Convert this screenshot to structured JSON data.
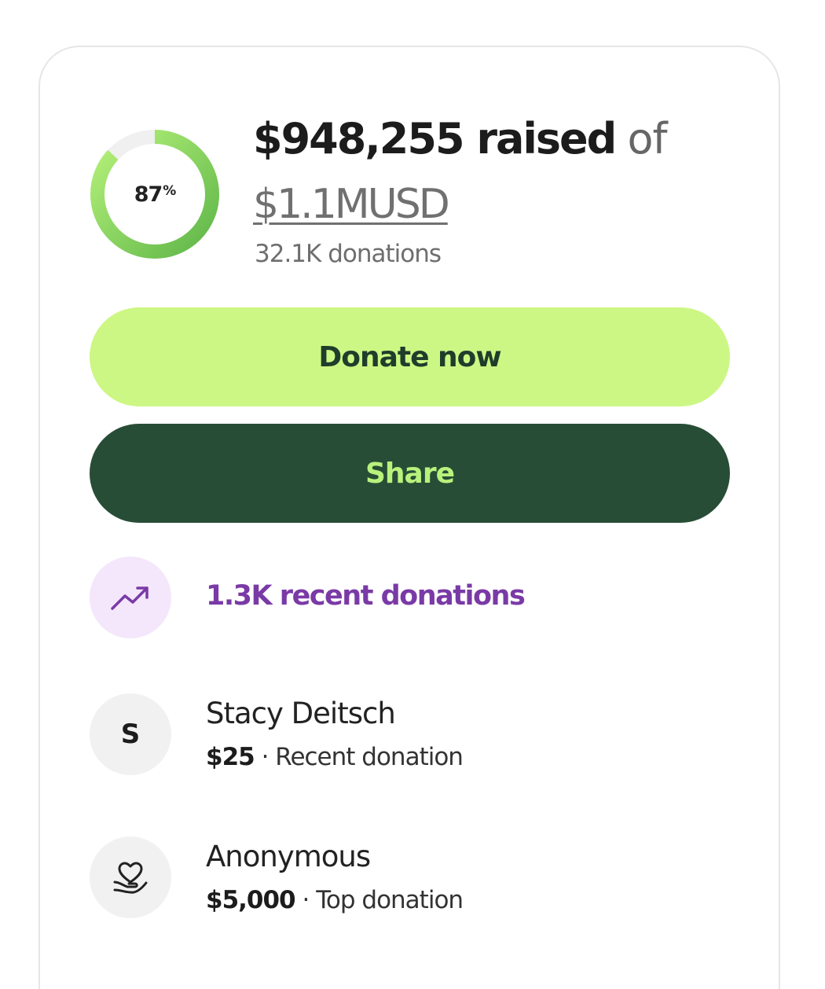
{
  "progress": {
    "percent_label": "87",
    "percent_sign": "%",
    "fraction": 0.87
  },
  "raised": {
    "amount": "$948,255 raised",
    "of": "of",
    "goal": "$1.1MUSD",
    "donations_count": "32.1K donations"
  },
  "buttons": {
    "donate_label": "Donate now",
    "share_label": "Share"
  },
  "trend": {
    "text": "1.3K recent donations",
    "icon": "trending-up-icon"
  },
  "donors": [
    {
      "avatar_letter": "S",
      "name": "Stacy Deitsch",
      "amount": "$25",
      "separator": "·",
      "type": "Recent donation"
    },
    {
      "avatar_icon": "heart-hand-icon",
      "name": "Anonymous",
      "amount": "$5,000",
      "separator": "·",
      "type": "Top donation"
    }
  ],
  "colors": {
    "ring_start": "#5fb649",
    "ring_end": "#b6f27a",
    "ring_track": "#f0f0f0",
    "donate_bg": "#cdf784",
    "share_bg": "#284d36",
    "share_text": "#b8f27c",
    "trend_purple": "#7a3aa6"
  }
}
